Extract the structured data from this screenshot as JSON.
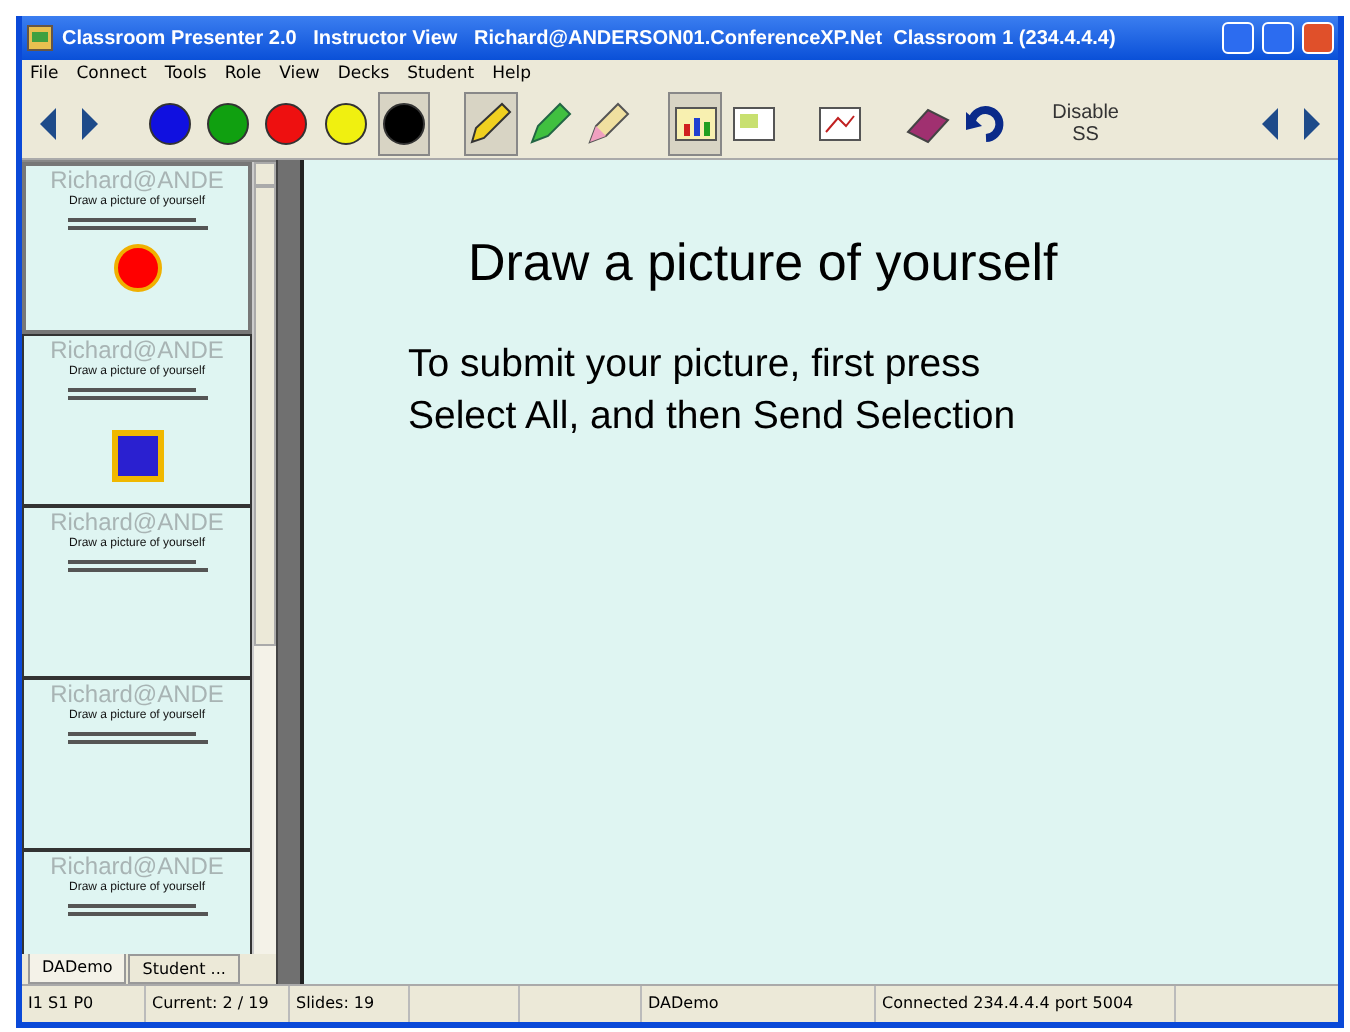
{
  "window": {
    "title": "Classroom Presenter 2.0   Instructor View   Richard@ANDERSON01.ConferenceXP.Net  Classroom 1 (234.4.4.4)"
  },
  "menu": [
    "File",
    "Connect",
    "Tools",
    "Role",
    "View",
    "Decks",
    "Student",
    "Help"
  ],
  "toolbar": [
    {
      "kind": "prev",
      "selected": false
    },
    {
      "kind": "next",
      "selected": false
    },
    {
      "kind": "pen",
      "color": "#1010e0",
      "selected": false
    },
    {
      "kind": "pen",
      "color": "#10a010",
      "selected": false
    },
    {
      "kind": "pen",
      "color": "#ee1010",
      "selected": false
    },
    {
      "kind": "pen",
      "color": "#f0f010",
      "selected": false
    },
    {
      "kind": "pen",
      "color": "#000000",
      "selected": true
    },
    {
      "kind": "pencil",
      "selected": true
    },
    {
      "kind": "highlighter",
      "selected": false
    },
    {
      "kind": "eraser-pen",
      "selected": false
    },
    {
      "kind": "slide-view",
      "selected": true
    },
    {
      "kind": "slide-mini",
      "selected": false
    },
    {
      "kind": "ink-view",
      "selected": false
    },
    {
      "kind": "eraser",
      "selected": false
    },
    {
      "kind": "undo",
      "selected": false
    },
    {
      "kind": "text",
      "label": "Disable\nSS",
      "selected": false
    },
    {
      "kind": "prev",
      "selected": false
    },
    {
      "kind": "next",
      "selected": false
    }
  ],
  "slides": [
    {
      "watermark": "Richard@ANDE",
      "title": "Draw a picture of yourself",
      "kind": "circle",
      "selected": true
    },
    {
      "watermark": "Richard@ANDE",
      "title": "Draw a picture of yourself",
      "kind": "square",
      "selected": false
    },
    {
      "watermark": "Richard@ANDE",
      "title": "Draw a picture of yourself",
      "kind": "plain",
      "selected": false
    },
    {
      "watermark": "Richard@ANDE",
      "title": "Draw a picture of yourself",
      "kind": "plain",
      "selected": false
    },
    {
      "watermark": "Richard@ANDE",
      "title": "Draw a picture of yourself",
      "kind": "plain",
      "selected": false
    }
  ],
  "deck_tabs": [
    {
      "label": "DADemo",
      "selected": true
    },
    {
      "label": "Student ...",
      "selected": false
    }
  ],
  "current_slide": {
    "title": "Draw a picture of yourself",
    "body": "To submit your picture, first press\nSelect All, and then Send Selection"
  },
  "status_bar": [
    "I1  S1  P0",
    "Current: 2 / 19",
    "Slides: 19",
    "DADemo",
    "Connected 234.4.4.4 port 5004"
  ]
}
